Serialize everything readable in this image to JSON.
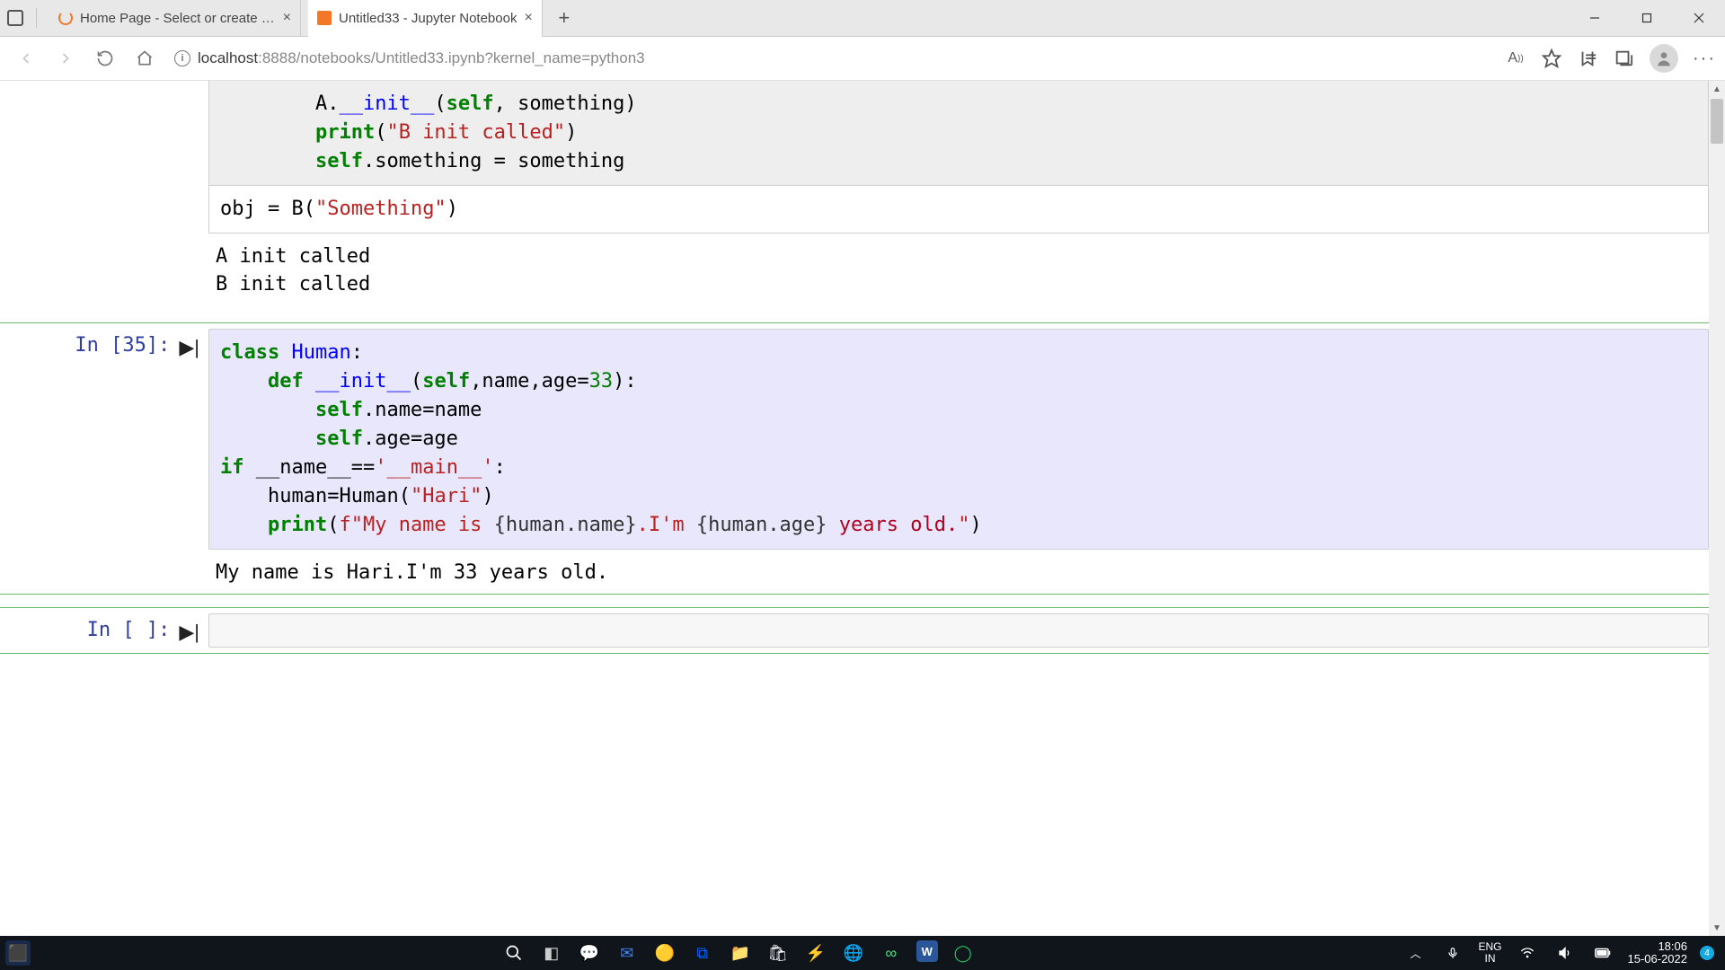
{
  "window": {
    "tabs": [
      {
        "title": "Home Page - Select or create a n",
        "active": false
      },
      {
        "title": "Untitled33 - Jupyter Notebook",
        "active": true
      }
    ],
    "url_host": "localhost",
    "url_port_path": ":8888/notebooks/Untitled33.ipynb?kernel_name=python3"
  },
  "cells": {
    "cell0": {
      "code_top_lines": [
        [
          {
            "t": "        A.",
            "c": ""
          },
          {
            "t": "__init__",
            "c": "fn"
          },
          {
            "t": "(",
            "c": ""
          },
          {
            "t": "self",
            "c": "kw"
          },
          {
            "t": ", something)",
            "c": ""
          }
        ],
        [
          {
            "t": "        ",
            "c": ""
          },
          {
            "t": "print",
            "c": "kw"
          },
          {
            "t": "(",
            "c": ""
          },
          {
            "t": "\"B init called\"",
            "c": "str"
          },
          {
            "t": ")",
            "c": ""
          }
        ],
        [
          {
            "t": "        ",
            "c": ""
          },
          {
            "t": "self",
            "c": "kw"
          },
          {
            "t": ".something ",
            "c": ""
          },
          {
            "t": "=",
            "c": ""
          },
          {
            "t": " something",
            "c": ""
          }
        ],
        [
          {
            "t": "",
            "c": ""
          }
        ]
      ],
      "code_last_line": [
        {
          "t": "obj ",
          "c": ""
        },
        {
          "t": "=",
          "c": ""
        },
        {
          "t": " B(",
          "c": ""
        },
        {
          "t": "\"Something\"",
          "c": "str"
        },
        {
          "t": ")",
          "c": ""
        }
      ],
      "output": "A init called\nB init called"
    },
    "cell1": {
      "prompt": "In [35]:",
      "code_lines": [
        [
          {
            "t": "class",
            "c": "kw"
          },
          {
            "t": " ",
            "c": ""
          },
          {
            "t": "Human",
            "c": "fn"
          },
          {
            "t": ":",
            "c": ""
          }
        ],
        [
          {
            "t": "    ",
            "c": ""
          },
          {
            "t": "def",
            "c": "kw"
          },
          {
            "t": " ",
            "c": ""
          },
          {
            "t": "__init__",
            "c": "fn"
          },
          {
            "t": "(",
            "c": ""
          },
          {
            "t": "self",
            "c": "kw"
          },
          {
            "t": ",name,age",
            "c": ""
          },
          {
            "t": "=",
            "c": ""
          },
          {
            "t": "33",
            "c": "num"
          },
          {
            "t": "):",
            "c": ""
          }
        ],
        [
          {
            "t": "        ",
            "c": ""
          },
          {
            "t": "self",
            "c": "kw"
          },
          {
            "t": ".name",
            "c": ""
          },
          {
            "t": "=",
            "c": ""
          },
          {
            "t": "name",
            "c": ""
          }
        ],
        [
          {
            "t": "        ",
            "c": ""
          },
          {
            "t": "self",
            "c": "kw"
          },
          {
            "t": ".age",
            "c": ""
          },
          {
            "t": "=",
            "c": ""
          },
          {
            "t": "age",
            "c": ""
          }
        ],
        [
          {
            "t": "if",
            "c": "kw"
          },
          {
            "t": " __name__",
            "c": ""
          },
          {
            "t": "==",
            "c": ""
          },
          {
            "t": "'__main__'",
            "c": "str"
          },
          {
            "t": ":",
            "c": ""
          }
        ],
        [
          {
            "t": "    human",
            "c": ""
          },
          {
            "t": "=",
            "c": ""
          },
          {
            "t": "Human(",
            "c": ""
          },
          {
            "t": "\"Hari\"",
            "c": "str"
          },
          {
            "t": ")",
            "c": ""
          }
        ],
        [
          {
            "t": "    ",
            "c": ""
          },
          {
            "t": "print",
            "c": "kw"
          },
          {
            "t": "(",
            "c": ""
          },
          {
            "t": "f\"My name is ",
            "c": "str"
          },
          {
            "t": "{human.name}",
            "c": "fstr-in"
          },
          {
            "t": ".I'm ",
            "c": "str"
          },
          {
            "t": "{human.age}",
            "c": "fstr-in"
          },
          {
            "t": " years old.",
            "c": "err"
          },
          {
            "t": "\"",
            "c": "str"
          },
          {
            "t": ")",
            "c": ""
          }
        ]
      ],
      "output": "My name is Hari.I'm 33 years old."
    },
    "cell2": {
      "prompt": "In [ ]:",
      "code": ""
    }
  },
  "taskbar": {
    "lang_top": "ENG",
    "lang_bot": "IN",
    "time": "18:06",
    "date": "15-06-2022",
    "badge": "4"
  }
}
